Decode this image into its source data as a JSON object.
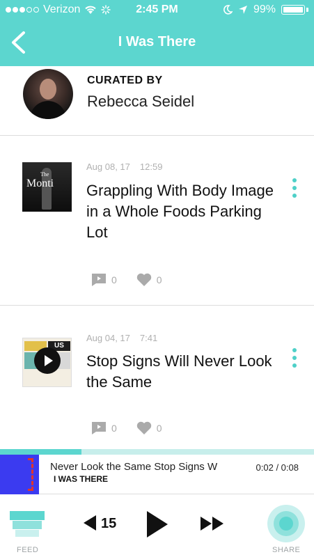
{
  "status": {
    "carrier": "Verizon",
    "time": "2:45 PM",
    "battery": "99%"
  },
  "nav": {
    "title": "I Was There"
  },
  "curator": {
    "label": "CURATED BY",
    "name": "Rebecca Seidel"
  },
  "episodes": [
    {
      "date": "Aug 08, 17",
      "duration": "12:59",
      "title": "Grappling With Body Image in a Whole Foods Parking Lot",
      "thumb_text": "Monti",
      "thumb_small": "The",
      "comments": "0",
      "likes": "0"
    },
    {
      "date": "Aug 04, 17",
      "duration": "7:41",
      "title": "Stop Signs Will Never Look the Same",
      "thumb_text": "US",
      "comments": "0",
      "likes": "0"
    }
  ],
  "player": {
    "marquee": "Never Look the Same     Stop Signs W",
    "subtitle": "I WAS THERE",
    "time": "0:02 / 0:08",
    "progress": 0.26
  },
  "bottom": {
    "feed_label": "FEED",
    "skip_back": "15",
    "share_label": "SHARE"
  },
  "colors": {
    "accent": "#5cd6cf",
    "accent_light": "#c7eeeb"
  }
}
